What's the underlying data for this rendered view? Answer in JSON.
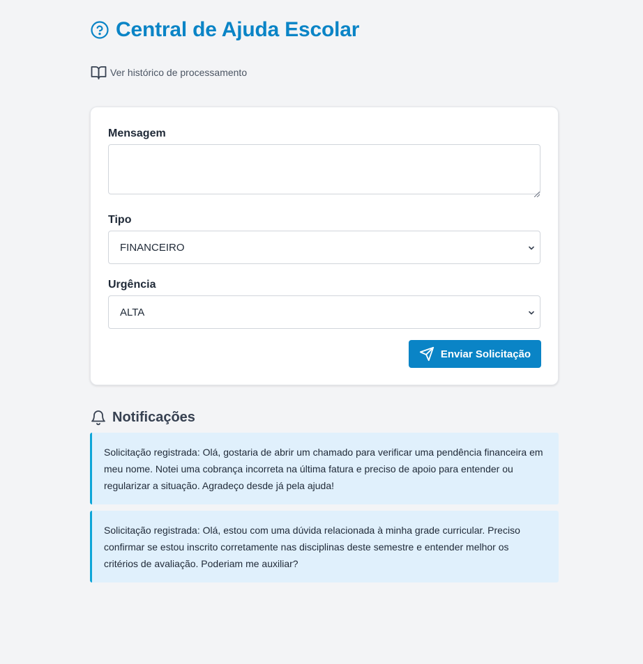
{
  "header": {
    "title": "Central de Ajuda Escolar",
    "title_icon": "question-circle-icon",
    "history_link": "Ver histórico de processamento",
    "history_icon": "book-open-icon"
  },
  "form": {
    "message_label": "Mensagem",
    "message_value": "",
    "type_label": "Tipo",
    "type_value": "FINANCEIRO",
    "urgency_label": "Urgência",
    "urgency_value": "ALTA",
    "submit_label": "Enviar Solicitação",
    "submit_icon": "send-icon"
  },
  "notifications": {
    "heading": "Notificações",
    "heading_icon": "bell-icon",
    "items": [
      {
        "text": "Solicitação registrada: Olá, gostaria de abrir um chamado para verificar uma pendência financeira em meu nome. Notei uma cobrança incorreta na última fatura e preciso de apoio para entender ou regularizar a situação. Agradeço desde já pela ajuda!"
      },
      {
        "text": "Solicitação registrada: Olá, estou com uma dúvida relacionada à minha grade curricular. Preciso confirmar se estou inscrito corretamente nas disciplinas deste semestre e entender melhor os critérios de avaliação. Poderiam me auxiliar?"
      }
    ]
  },
  "colors": {
    "brand": "#0a84c6",
    "background": "#f3f4f6",
    "notification_bg": "#e0f0fc",
    "notification_border": "#0ea5d8"
  }
}
